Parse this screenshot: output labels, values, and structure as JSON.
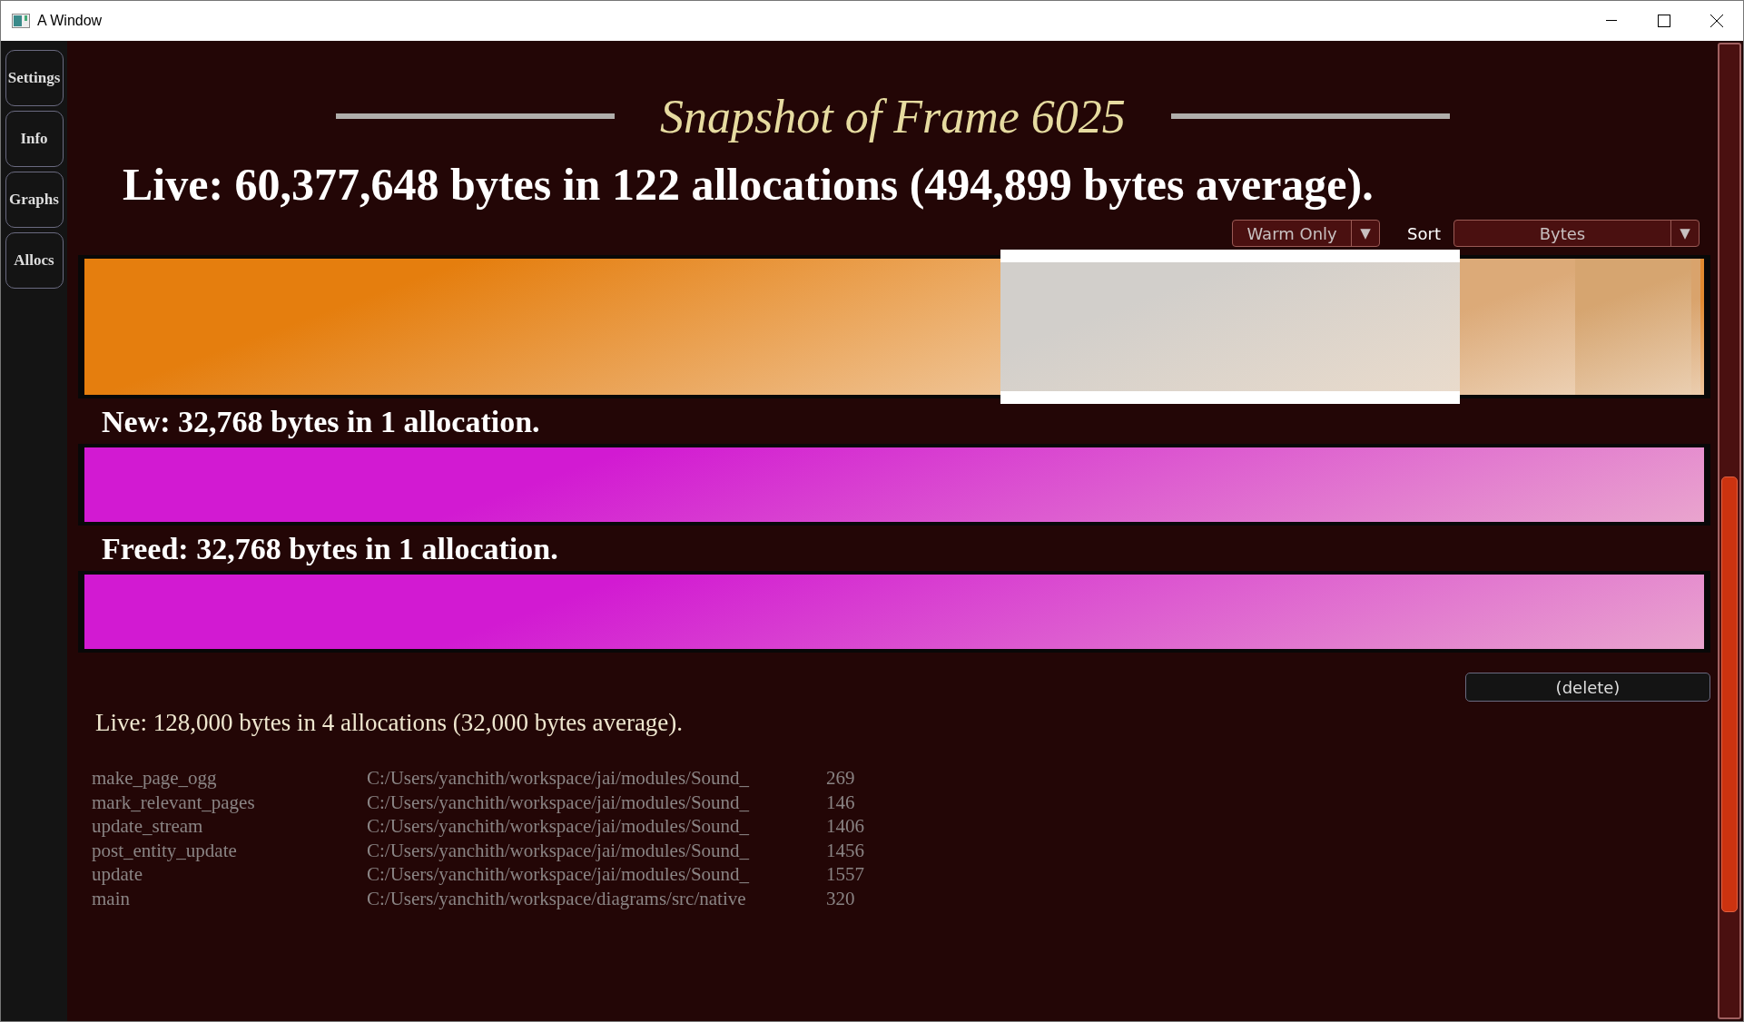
{
  "window": {
    "title": "A Window"
  },
  "sidebar": {
    "items": [
      {
        "label": "Settings"
      },
      {
        "label": "Info"
      },
      {
        "label": "Graphs"
      },
      {
        "label": "Allocs"
      }
    ]
  },
  "heading": "Snapshot of Frame 6025",
  "live_summary": "Live: 60,377,648 bytes in 122 allocations (494,899 bytes average).",
  "filter": {
    "value": "Warm Only",
    "arrow": "▼"
  },
  "sort": {
    "label": "Sort",
    "value": "Bytes",
    "arrow": "▼"
  },
  "live_bar": {
    "segments": [
      {
        "color": "#e57e0e",
        "selected": false
      },
      {
        "color": "#d2cfcb",
        "selected": true
      },
      {
        "color": "#dcaa78",
        "selected": false
      },
      {
        "color": "#d6a570",
        "selected": false
      },
      {
        "color": "#d9a36c",
        "selected": false
      },
      {
        "color": "#e08a30",
        "selected": false
      }
    ]
  },
  "new": {
    "text": "New: 32,768 bytes in 1 allocation.",
    "color": "#d21ad2"
  },
  "freed": {
    "text": "Freed: 32,768 bytes in 1 allocation.",
    "color": "#d21ad2"
  },
  "delete_button": "(delete)",
  "detail_summary": "Live: 128,000 bytes in 4 allocations (32,000 bytes average).",
  "stack": [
    {
      "function": "make_page_ogg",
      "file": "C:/Users/yanchith/workspace/jai/modules/Sound_",
      "line": "269"
    },
    {
      "function": "mark_relevant_pages",
      "file": "C:/Users/yanchith/workspace/jai/modules/Sound_",
      "line": "146"
    },
    {
      "function": "update_stream",
      "file": "C:/Users/yanchith/workspace/jai/modules/Sound_",
      "line": "1406"
    },
    {
      "function": "post_entity_update",
      "file": "C:/Users/yanchith/workspace/jai/modules/Sound_",
      "line": "1456"
    },
    {
      "function": "update",
      "file": "C:/Users/yanchith/workspace/jai/modules/Sound_",
      "line": "1557"
    },
    {
      "function": "main",
      "file": "C:/Users/yanchith/workspace/diagrams/src/native",
      "line": "320"
    }
  ]
}
